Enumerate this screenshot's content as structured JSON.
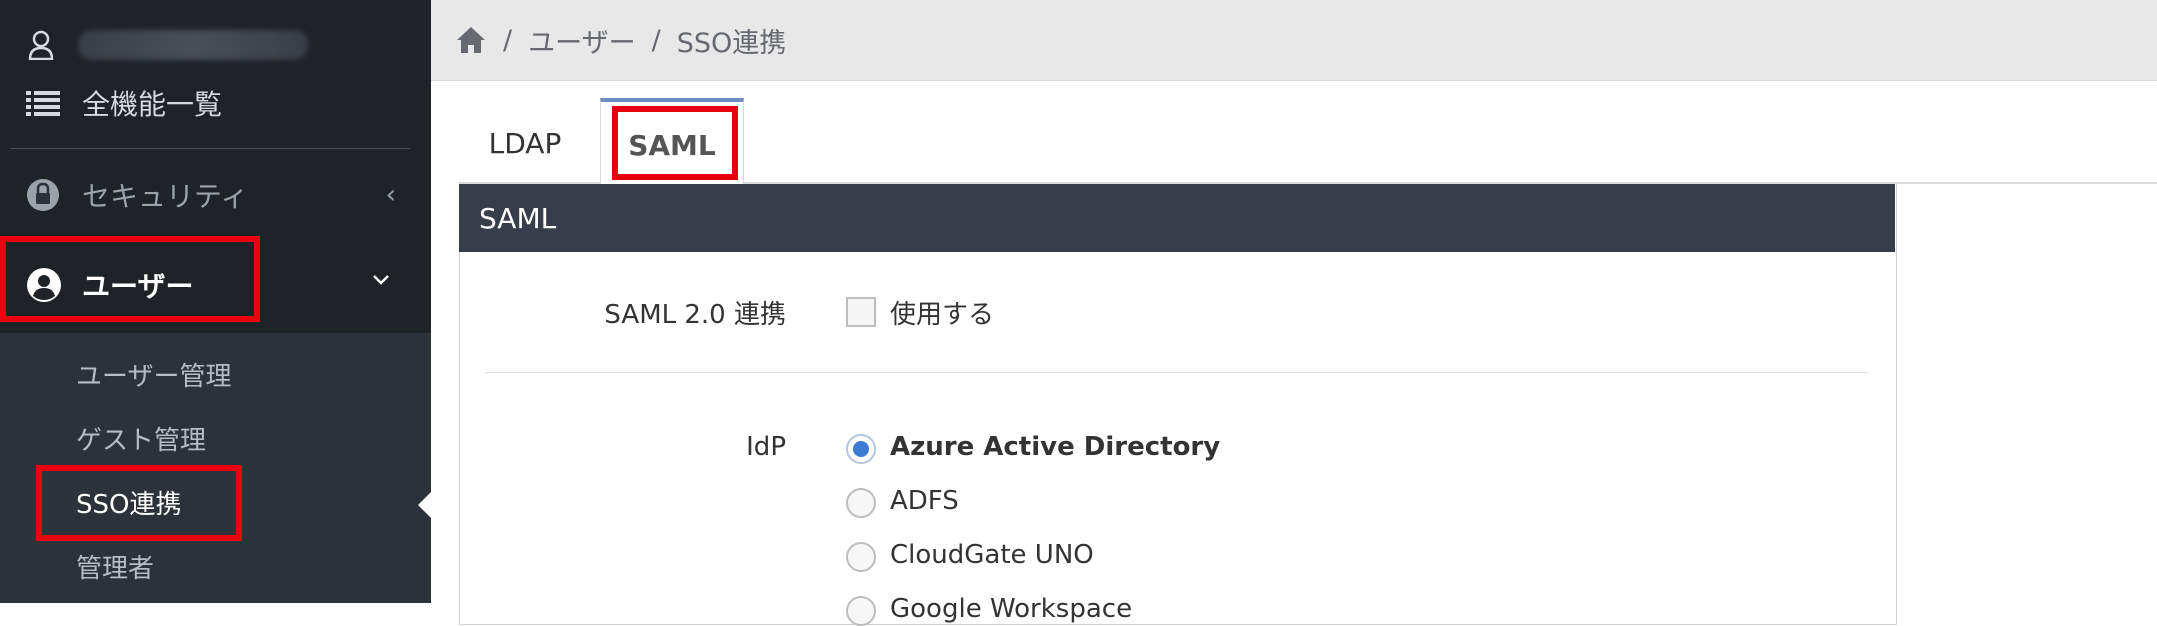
{
  "sidebar": {
    "menu_all": "全機能一覧",
    "security": "セキュリティ",
    "user": "ユーザー",
    "sub_items": [
      "ユーザー管理",
      "ゲスト管理",
      "SSO連携",
      "管理者"
    ]
  },
  "breadcrumb": {
    "items": [
      "ユーザー",
      "SSO連携"
    ],
    "separator": "/"
  },
  "tabs": [
    "LDAP",
    "SAML"
  ],
  "panel": {
    "title": "SAML",
    "saml_label": "SAML 2.0 連携",
    "use_label": "使用する",
    "idp_label": "IdP",
    "idp_options": [
      "Azure Active Directory",
      "ADFS",
      "CloudGate UNO",
      "Google Workspace"
    ]
  },
  "colors": {
    "highlight_red": "#e8000f",
    "sidebar_bg": "#2d3139",
    "panel_header": "#373d4a",
    "radio_selected": "#3b7bd4"
  }
}
